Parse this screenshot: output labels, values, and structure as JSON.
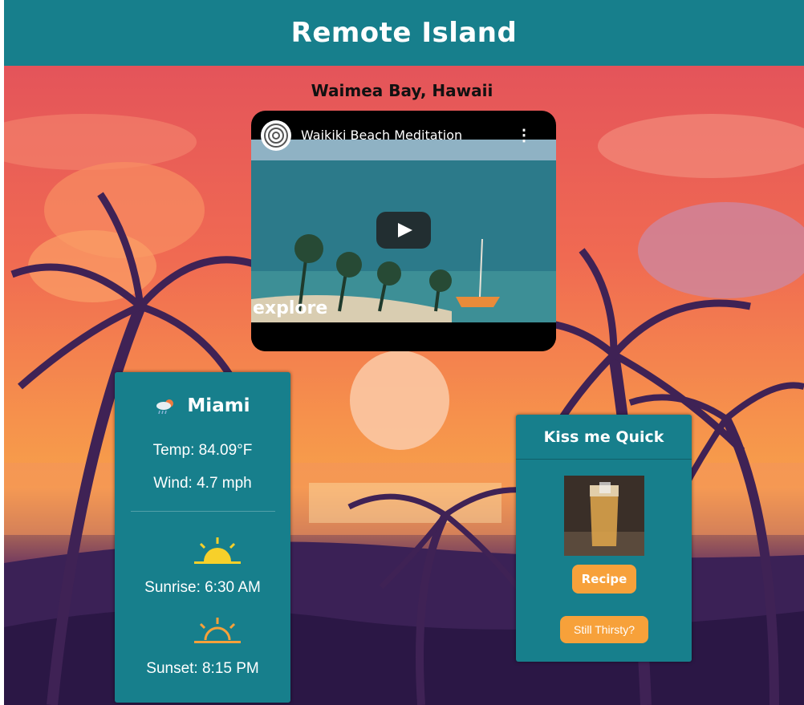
{
  "header": {
    "title": "Remote Island"
  },
  "location": {
    "name": "Waimea Bay, Hawaii"
  },
  "video": {
    "title": "Waikiki Beach Meditation",
    "watermark": "explore",
    "more_icon": "more-vert-icon",
    "play_icon": "play-icon"
  },
  "weather": {
    "icon": "rain-cloud-icon",
    "city": "Miami",
    "temp": "Temp: 84.09°F",
    "wind": "Wind: 4.7 mph",
    "sunrise_icon": "sunrise-icon",
    "sunrise": "Sunrise: 6:30 AM",
    "sunset_icon": "sunset-icon",
    "sunset": "Sunset: 8:15 PM"
  },
  "drink": {
    "title": "Kiss me Quick",
    "recipe_label": "Recipe",
    "more_label": "Still Thirsty?"
  },
  "colors": {
    "header": "#177f8c",
    "card": "#177f8c",
    "button": "#f7a13a",
    "sun_yellow": "#f7d02a",
    "sunset_orange": "#f7a13a"
  }
}
